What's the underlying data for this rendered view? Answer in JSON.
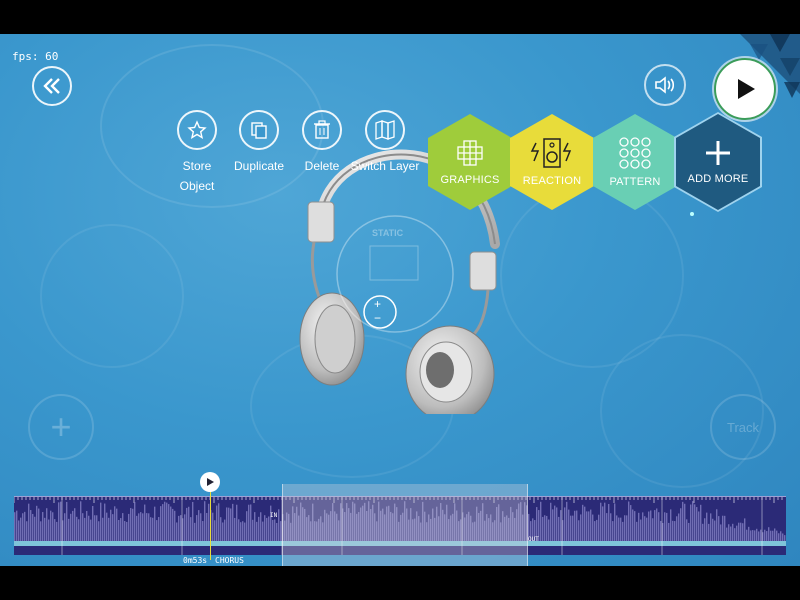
{
  "fps_label": "fps: 60",
  "toolbar": {
    "store": "Store\nObject",
    "duplicate": "Duplicate",
    "delete": "Delete",
    "switch_layer": "Switch Layer"
  },
  "categories": [
    {
      "label": "GRAPHICS",
      "color": "#9fcc3b"
    },
    {
      "label": "REACTION",
      "color": "#e8dc3a"
    },
    {
      "label": "PATTERN",
      "color": "#69cfb4"
    },
    {
      "label": "ADD MORE",
      "color": "#1f5a80"
    }
  ],
  "center": {
    "static_label": "STATIC"
  },
  "track_label": "Track",
  "timeline": {
    "time": "0m53s",
    "section": "CHORUS",
    "in_tag": "IN",
    "out_tag": "OUT"
  },
  "colors": {
    "background": "#3a97cd",
    "timeline_bg": "#2b2a77",
    "waveform": "#8a86c8",
    "progress": "#7fc4d9"
  }
}
